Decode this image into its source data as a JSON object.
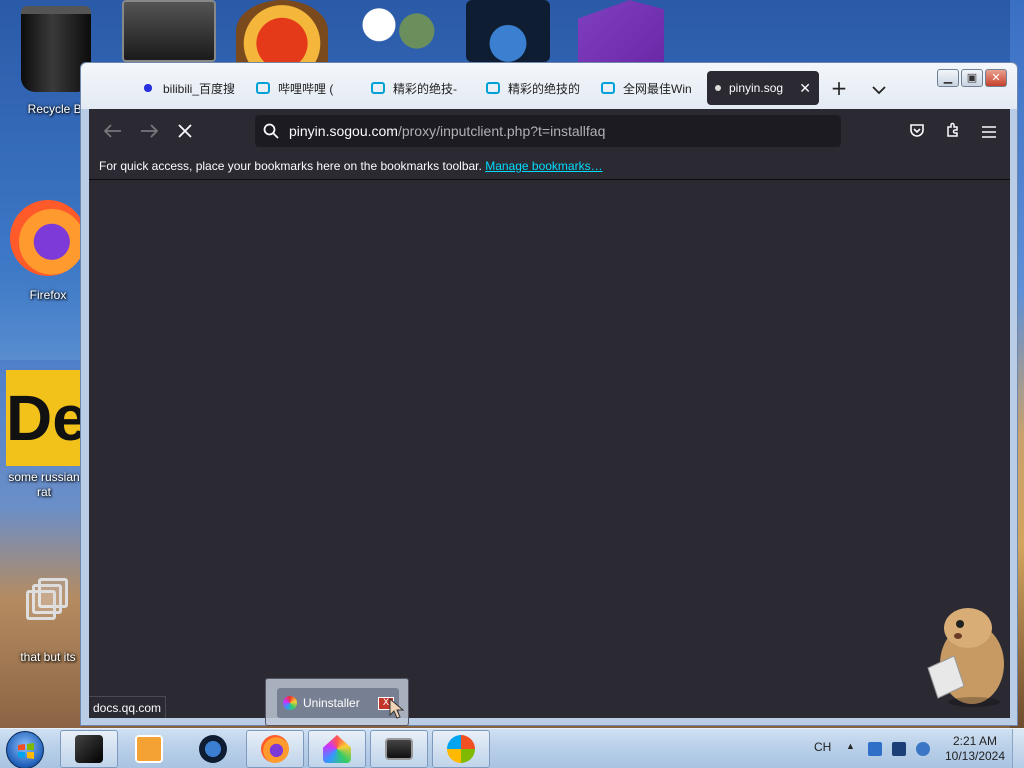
{
  "desktop": {
    "icons": [
      {
        "label": "Recycle Bi"
      },
      {
        "label": "Firefox"
      },
      {
        "label": "some russian rat"
      },
      {
        "label": "that but its"
      }
    ]
  },
  "browser": {
    "tabs": [
      {
        "label": "bilibili_百度搜",
        "icon": "baidu-paw-icon"
      },
      {
        "label": "哔哩哔哩 (",
        "icon": "bilibili-tv-icon"
      },
      {
        "label": "精彩的绝技-",
        "icon": "bilibili-tv-icon"
      },
      {
        "label": "精彩的绝技的",
        "icon": "bilibili-tv-icon"
      },
      {
        "label": "全网最佳Win",
        "icon": "bilibili-tv-icon"
      },
      {
        "label": "pinyin.sog",
        "icon": "loading-dot-icon",
        "active": true
      }
    ],
    "new_tab_symbol": "+",
    "list_tabs_symbol": "⌄",
    "url": {
      "host": "pinyin.sogou.com",
      "path": "/proxy/inputclient.php?t=installfaq"
    },
    "bookmarks_bar": {
      "message": "For quick access, place your bookmarks here on the bookmarks toolbar.",
      "link": "Manage bookmarks…"
    },
    "status_url": "docs.qq.com"
  },
  "thumbnail_popup": {
    "title": "Uninstaller",
    "close_glyph": "X"
  },
  "tray": {
    "language": "CH",
    "time": "2:21 AM",
    "date": "10/13/2024"
  },
  "colors": {
    "browser_chrome": "#2b2a33",
    "urlbar": "#1c1b22",
    "link": "#00ddff"
  }
}
